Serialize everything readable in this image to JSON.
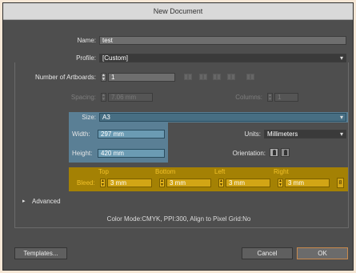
{
  "window": {
    "title": "New Document"
  },
  "name": {
    "label": "Name:",
    "value": "test"
  },
  "profile": {
    "label": "Profile:",
    "value": "[Custom]"
  },
  "artboards": {
    "label": "Number of Artboards:",
    "value": "1"
  },
  "spacing": {
    "label": "Spacing:",
    "value": "7.06 mm"
  },
  "columns": {
    "label": "Columns:",
    "value": "1"
  },
  "size": {
    "label": "Size:",
    "value": "A3"
  },
  "width": {
    "label": "Width:",
    "value": "297 mm"
  },
  "height": {
    "label": "Height:",
    "value": "420 mm"
  },
  "units": {
    "label": "Units:",
    "value": "Millimeters"
  },
  "orientation": {
    "label": "Orientation:"
  },
  "bleed": {
    "label": "Bleed:",
    "top": {
      "label": "Top",
      "value": "3 mm"
    },
    "bottom": {
      "label": "Bottom",
      "value": "3 mm"
    },
    "left": {
      "label": "Left",
      "value": "3 mm"
    },
    "right": {
      "label": "Right",
      "value": "3 mm"
    }
  },
  "advanced": {
    "label": "Advanced"
  },
  "summary": "Color Mode:CMYK, PPI:300, Align to Pixel Grid:No",
  "buttons": {
    "templates": "Templates...",
    "cancel": "Cancel",
    "ok": "OK"
  },
  "colors": {
    "background": "#4e4e4e",
    "highlight_blue": "#5a7f95",
    "bleed_yellow": "#d2a515",
    "ok_border": "#c98a4d"
  }
}
